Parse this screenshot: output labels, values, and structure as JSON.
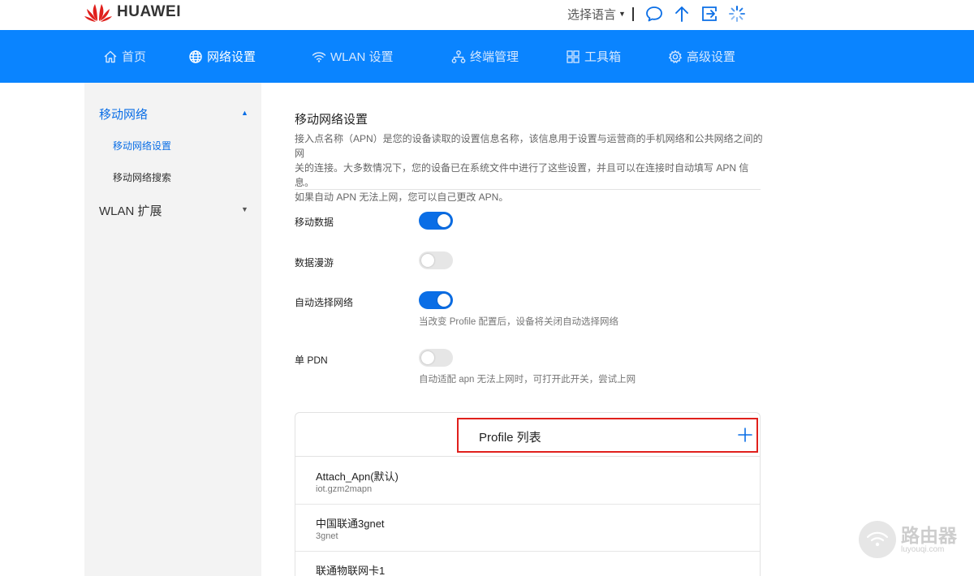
{
  "brand": {
    "name": "HUAWEI",
    "color": "#e0201c"
  },
  "topbar": {
    "language_label": "选择语言",
    "icons": [
      "chat-icon",
      "upload-icon",
      "logout-icon",
      "loading-icon"
    ]
  },
  "colors": {
    "accent": "#0a84ff",
    "link": "#0a6ee6",
    "highlight": "#e0201c"
  },
  "nav": {
    "items": [
      {
        "label": "首页",
        "icon": "home-icon"
      },
      {
        "label": "网络设置",
        "icon": "globe-icon",
        "active": true
      },
      {
        "label": "WLAN 设置",
        "icon": "wifi-icon"
      },
      {
        "label": "终端管理",
        "icon": "devices-icon"
      },
      {
        "label": "工具箱",
        "icon": "toolbox-icon"
      },
      {
        "label": "高级设置",
        "icon": "gear-icon"
      }
    ]
  },
  "sidebar": {
    "groups": [
      {
        "label": "移动网络",
        "expanded": true,
        "items": [
          {
            "label": "移动网络设置",
            "active": true
          },
          {
            "label": "移动网络搜索"
          }
        ]
      },
      {
        "label": "WLAN 扩展",
        "expanded": false
      }
    ]
  },
  "main": {
    "title": "移动网络设置",
    "description_lines": [
      "接入点名称（APN）是您的设备读取的设置信息名称，该信息用于设置与运营商的手机网络和公共网络之间的网",
      "关的连接。大多数情况下，您的设备已在系统文件中进行了这些设置，并且可以在连接时自动填写 APN 信息。",
      "如果自动 APN 无法上网，您可以自己更改 APN。"
    ],
    "settings": [
      {
        "label": "移动数据",
        "on": true
      },
      {
        "label": "数据漫游",
        "on": false
      },
      {
        "label": "自动选择网络",
        "on": true,
        "hint": "当改变 Profile 配置后，设备将关闭自动选择网络"
      },
      {
        "label": "单 PDN",
        "on": false,
        "hint": "自动适配 apn 无法上网时，可打开此开关，尝试上网"
      }
    ],
    "profiles": {
      "title": "Profile 列表",
      "items": [
        {
          "name": "Attach_Apn(默认)",
          "apn": "iot.gzm2mapn"
        },
        {
          "name": "中国联通3gnet",
          "apn": "3gnet"
        },
        {
          "name": "联通物联网卡1",
          "apn": ""
        }
      ]
    }
  },
  "watermark": {
    "name": "路由器",
    "url": "luyouqi.com"
  }
}
